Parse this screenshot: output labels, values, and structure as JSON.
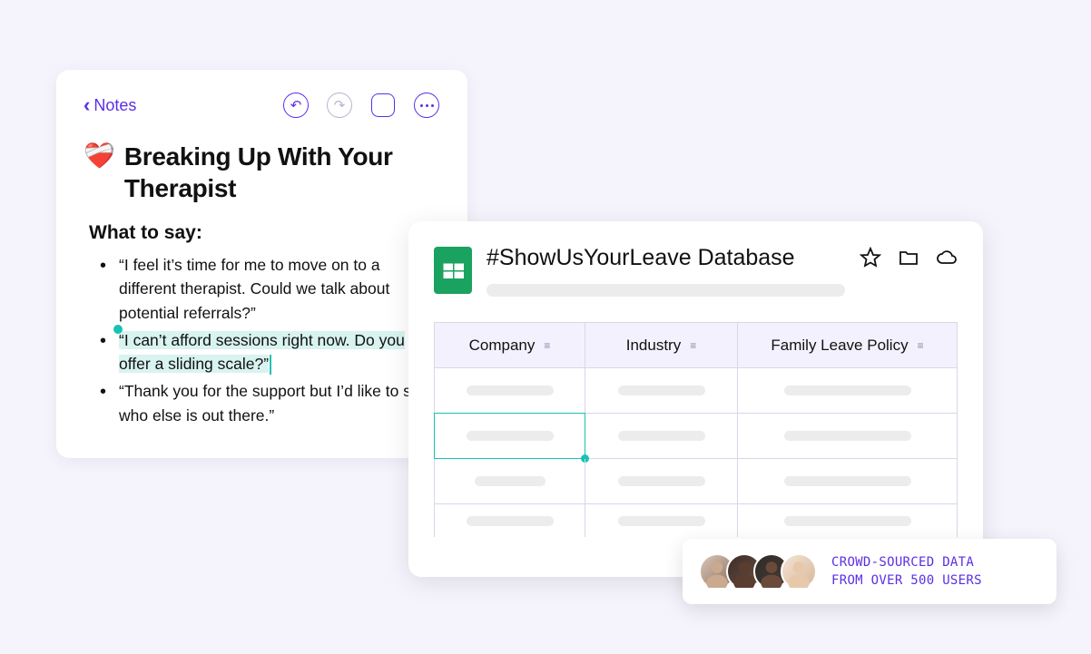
{
  "notes": {
    "back_label": "Notes",
    "title_emoji": "❤️‍🩹",
    "title": "Breaking Up With Your Therapist",
    "subheading": "What to say:",
    "bullets": [
      "“I feel it’s time for me to move on to a different therapist. Could we talk about potential referrals?”",
      "“I can’t afford sessions right now. Do you offer a sliding scale?”",
      "“Thank you for the support but I’d like to see who else is out there.”"
    ],
    "selected_bullet_index": 1
  },
  "sheet": {
    "title": "#ShowUsYourLeave Database",
    "columns": [
      "Company",
      "Industry",
      "Family Leave Policy"
    ]
  },
  "crowd": {
    "line1": "CROWD-SOURCED DATA",
    "line2": "FROM OVER 500 USERS"
  },
  "colors": {
    "accent": "#5b2ee6",
    "selection": "#17c3b2",
    "sheets_green": "#1aa260"
  }
}
